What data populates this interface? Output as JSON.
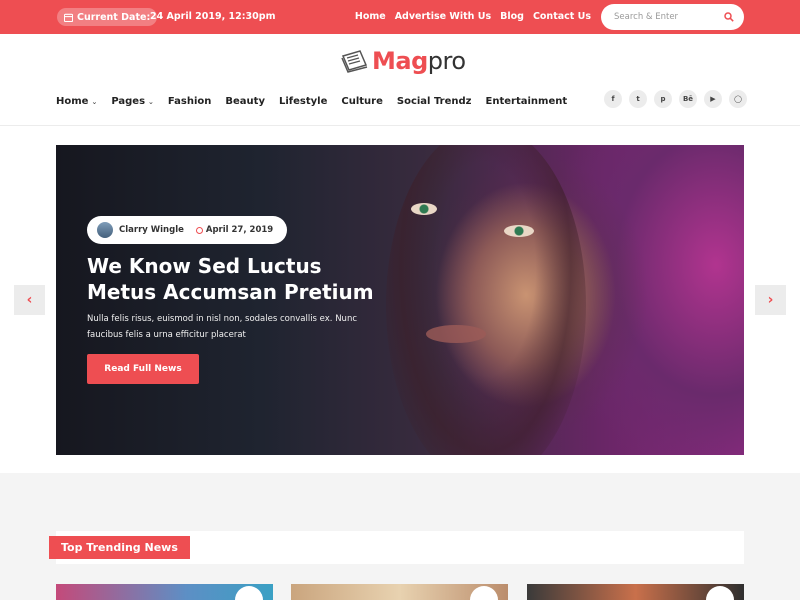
{
  "topbar": {
    "date_label": "Current Date:",
    "date_value": "24 April 2019, 12:30pm",
    "links": [
      "Home",
      "Advertise With Us",
      "Blog",
      "Contact Us"
    ],
    "search_placeholder": "Search & Enter"
  },
  "brand": {
    "logo_part1": "Mag",
    "logo_part2": "pro"
  },
  "nav": {
    "items": [
      "Home",
      "Pages",
      "Fashion",
      "Beauty",
      "Lifestyle",
      "Culture",
      "Social Trendz",
      "Entertainment"
    ],
    "social_icons": [
      "facebook-icon",
      "twitter-icon",
      "pinterest-icon",
      "behance-icon",
      "youtube-icon",
      "instagram-icon"
    ]
  },
  "hero": {
    "author": "Clarry Wingle",
    "date": "April 27, 2019",
    "title": "We Know Sed Luctus Metus Accumsan Pretium",
    "description": "Nulla felis risus, euismod in nisl non, sodales convallis ex. Nunc faucibus felis a urna efficitur placerat",
    "button": "Read Full News"
  },
  "trending": {
    "label": "Top Trending News"
  },
  "colors": {
    "accent": "#ee4e52"
  }
}
